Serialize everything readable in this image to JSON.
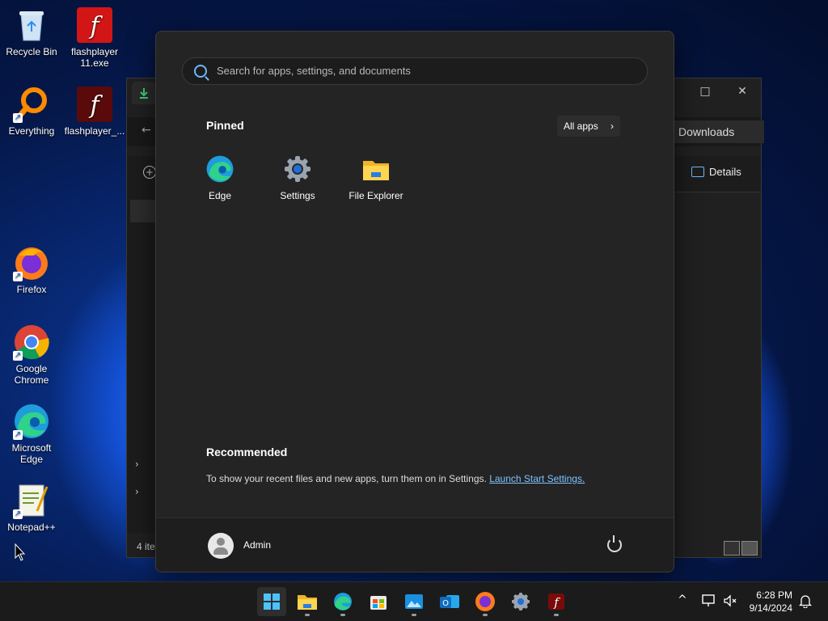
{
  "desktop": {
    "icons": [
      {
        "label": "Recycle Bin"
      },
      {
        "label": "flashplayer 11.exe"
      },
      {
        "label": "Everything"
      },
      {
        "label": "flashplayer_..."
      },
      {
        "label": "Firefox"
      },
      {
        "label": "Google Chrome"
      },
      {
        "label": "Microsoft Edge"
      },
      {
        "label": "Notepad++"
      }
    ]
  },
  "explorer": {
    "address": "Downloads",
    "details_label": "Details",
    "status": "4 ite"
  },
  "start_menu": {
    "search_placeholder": "Search for apps, settings, and documents",
    "pinned_title": "Pinned",
    "all_apps_label": "All apps",
    "pinned": [
      {
        "label": "Edge"
      },
      {
        "label": "Settings"
      },
      {
        "label": "File Explorer"
      }
    ],
    "recommended_title": "Recommended",
    "recommended_text": "To show your recent files and new apps, turn them on in Settings.",
    "recommended_link": "Launch Start Settings.",
    "user": "Admin"
  },
  "taskbar": {
    "time": "6:28 PM",
    "date": "9/14/2024"
  },
  "colors": {
    "accent": "#4cc2ff",
    "link": "#7fc3ff"
  }
}
